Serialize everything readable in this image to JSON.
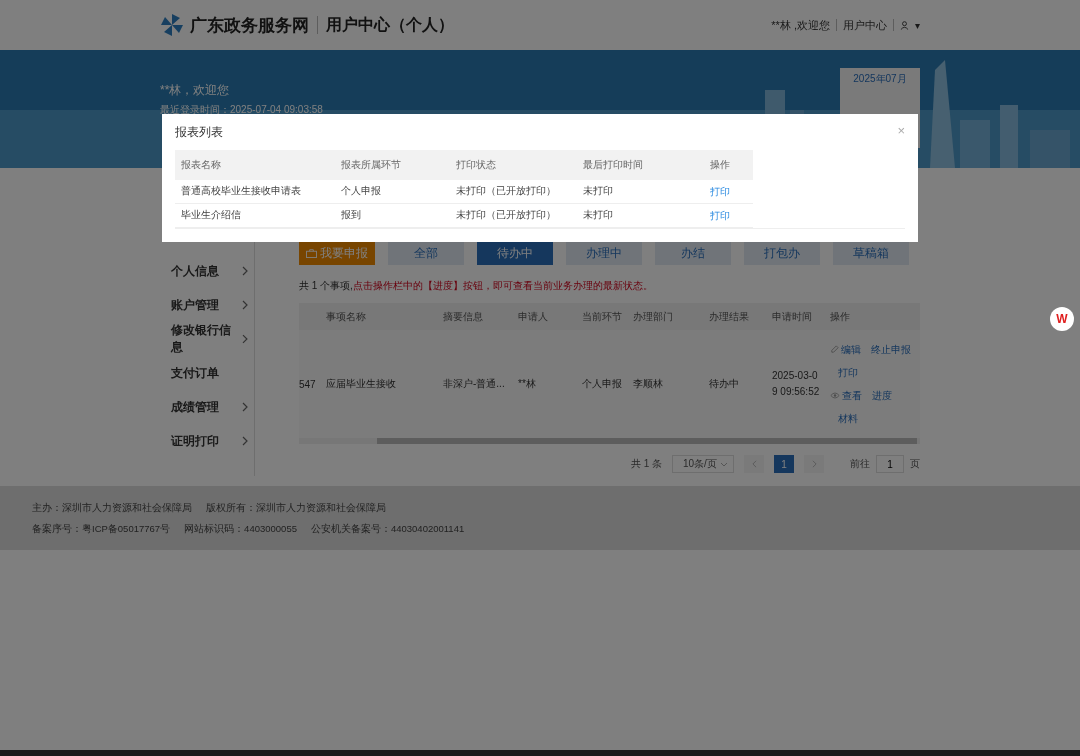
{
  "header": {
    "site_name": "广东政务服务网",
    "section": "用户中心（个人）",
    "greeting": "**林 ,欢迎您",
    "user_center": "用户中心",
    "user_caret": "▾"
  },
  "banner": {
    "greeting": "**林，欢迎您",
    "last_login": "最近登录时间：2025-07-04 09:03:58",
    "calendar_month": "2025年07月"
  },
  "sidebar": {
    "items": [
      {
        "label": "个人信息",
        "has_arrow": true
      },
      {
        "label": "账户管理",
        "has_arrow": true
      },
      {
        "label": "修改银行信息",
        "has_arrow": true
      },
      {
        "label": "支付订单",
        "has_arrow": false
      },
      {
        "label": "成绩管理",
        "has_arrow": true
      },
      {
        "label": "证明打印",
        "has_arrow": true
      }
    ]
  },
  "tabs": [
    {
      "kind": "apply",
      "label": "我要申报",
      "selected": false
    },
    {
      "kind": "status",
      "label": "全部",
      "selected": false
    },
    {
      "kind": "status",
      "label": "待办中",
      "selected": true
    },
    {
      "kind": "status",
      "label": "办理中",
      "selected": false
    },
    {
      "kind": "status",
      "label": "办结",
      "selected": false
    },
    {
      "kind": "status",
      "label": "打包办",
      "selected": false
    },
    {
      "kind": "status",
      "label": "草稿箱",
      "selected": false
    }
  ],
  "notice": {
    "count": "共 1 个事项,",
    "hint": "点击操作栏中的【进度】按钮，即可查看当前业务办理的最新状态。"
  },
  "table": {
    "columns": [
      "",
      "事项名称",
      "摘要信息",
      "申请人",
      "当前环节",
      "办理部门",
      "办理结果",
      "申请时间",
      "操作"
    ],
    "rows": [
      {
        "cells": [
          "547",
          "应届毕业生接收",
          "非深户-普通...",
          "**林",
          "个人申报",
          "李顺林",
          "待办中",
          "2025-03-09 09:56:52"
        ],
        "action_lines": [
          [
            {
              "kind": "edit",
              "label": "编辑"
            },
            {
              "kind": "plain",
              "label": "终止申报"
            }
          ],
          [
            {
              "kind": "plain",
              "label": "打印"
            }
          ],
          [
            {
              "kind": "view",
              "label": "查看"
            },
            {
              "kind": "plain",
              "label": "进度"
            }
          ],
          [
            {
              "kind": "plain",
              "label": "材料"
            }
          ]
        ]
      }
    ]
  },
  "pagination": {
    "total": "共 1 条",
    "page_size": "10条/页",
    "pages": [
      {
        "label": "1",
        "selected": true
      }
    ],
    "goto_label": "前往",
    "goto_value": "1",
    "goto_unit": "页"
  },
  "footer": {
    "lines": [
      [
        "主办：深圳市人力资源和社会保障局",
        "版权所有：深圳市人力资源和社会保障局"
      ],
      [
        "备案序号：粤ICP备05017767号",
        "网站标识码：4403000055",
        "公安机关备案号：44030402001141"
      ]
    ]
  },
  "modal": {
    "title": "报表列表",
    "close": "×",
    "columns": [
      "报表名称",
      "报表所属环节",
      "打印状态",
      "最后打印时间",
      "操作"
    ],
    "rows": [
      {
        "cells": [
          "普通高校毕业生接收申请表",
          "个人申报",
          "未打印（已开放打印）",
          "未打印"
        ],
        "action": "打印"
      },
      {
        "cells": [
          "毕业生介绍信",
          "报到",
          "未打印（已开放打印）",
          "未打印"
        ],
        "action": "打印"
      }
    ]
  },
  "floating_button": {
    "label": "W"
  }
}
